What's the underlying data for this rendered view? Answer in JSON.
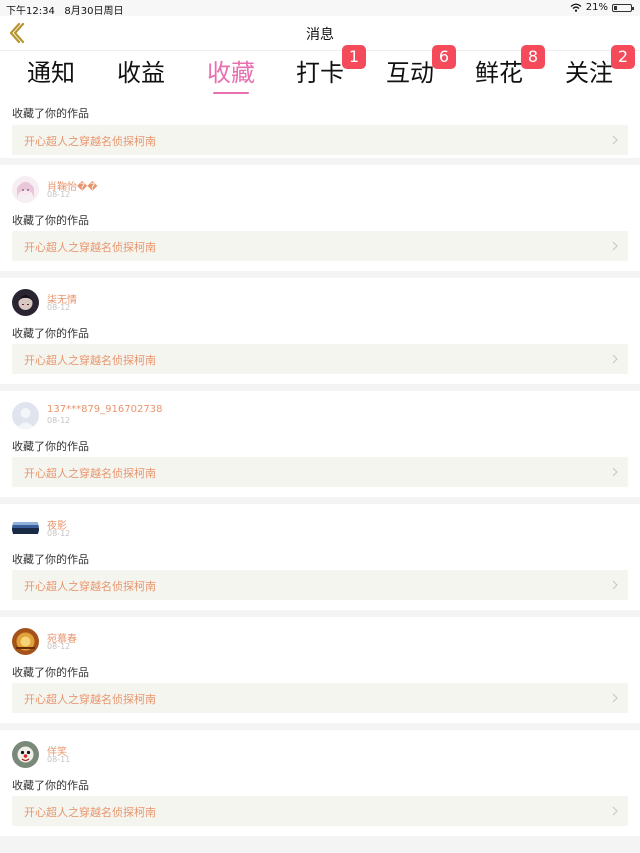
{
  "status": {
    "time": "下午12:34",
    "date": "8月30日周日",
    "battery": "21%",
    "battery_level": 0.21
  },
  "nav": {
    "title": "消息"
  },
  "tabs": [
    {
      "label": "通知",
      "badge": ""
    },
    {
      "label": "收益",
      "badge": ""
    },
    {
      "label": "收藏",
      "badge": "",
      "active": true
    },
    {
      "label": "打卡",
      "badge": "1"
    },
    {
      "label": "互动",
      "badge": "6"
    },
    {
      "label": "鲜花",
      "badge": "8"
    },
    {
      "label": "关注",
      "badge": "2"
    }
  ],
  "feed": {
    "first": {
      "action": "收藏了你的作品",
      "work": "开心超人之穿越名侦探柯南"
    },
    "items": [
      {
        "name": "肖鞠怡��",
        "date": "08-12",
        "action": "收藏了你的作品",
        "work": "开心超人之穿越名侦探柯南",
        "avatar": "anime-girl-avatar"
      },
      {
        "name": "柒无情",
        "date": "08-12",
        "action": "收藏了你的作品",
        "work": "开心超人之穿越名侦探柯南",
        "avatar": "dark-hair-avatar"
      },
      {
        "name": "137***879_916702738",
        "date": "08-12",
        "action": "收藏了你的作品",
        "work": "开心超人之穿越名侦探柯南",
        "avatar": "default-avatar"
      },
      {
        "name": "夜影",
        "date": "08-12",
        "action": "收藏了你的作品",
        "work": "开心超人之穿越名侦探柯南",
        "avatar": "landscape-avatar"
      },
      {
        "name": "宛慕春",
        "date": "08-12",
        "action": "收藏了你的作品",
        "work": "开心超人之穿越名侦探柯南",
        "avatar": "golden-avatar"
      },
      {
        "name": "佯笑",
        "date": "08-11",
        "action": "收藏了你的作品",
        "work": "开心超人之穿越名侦探柯南",
        "avatar": "clown-avatar"
      }
    ]
  }
}
